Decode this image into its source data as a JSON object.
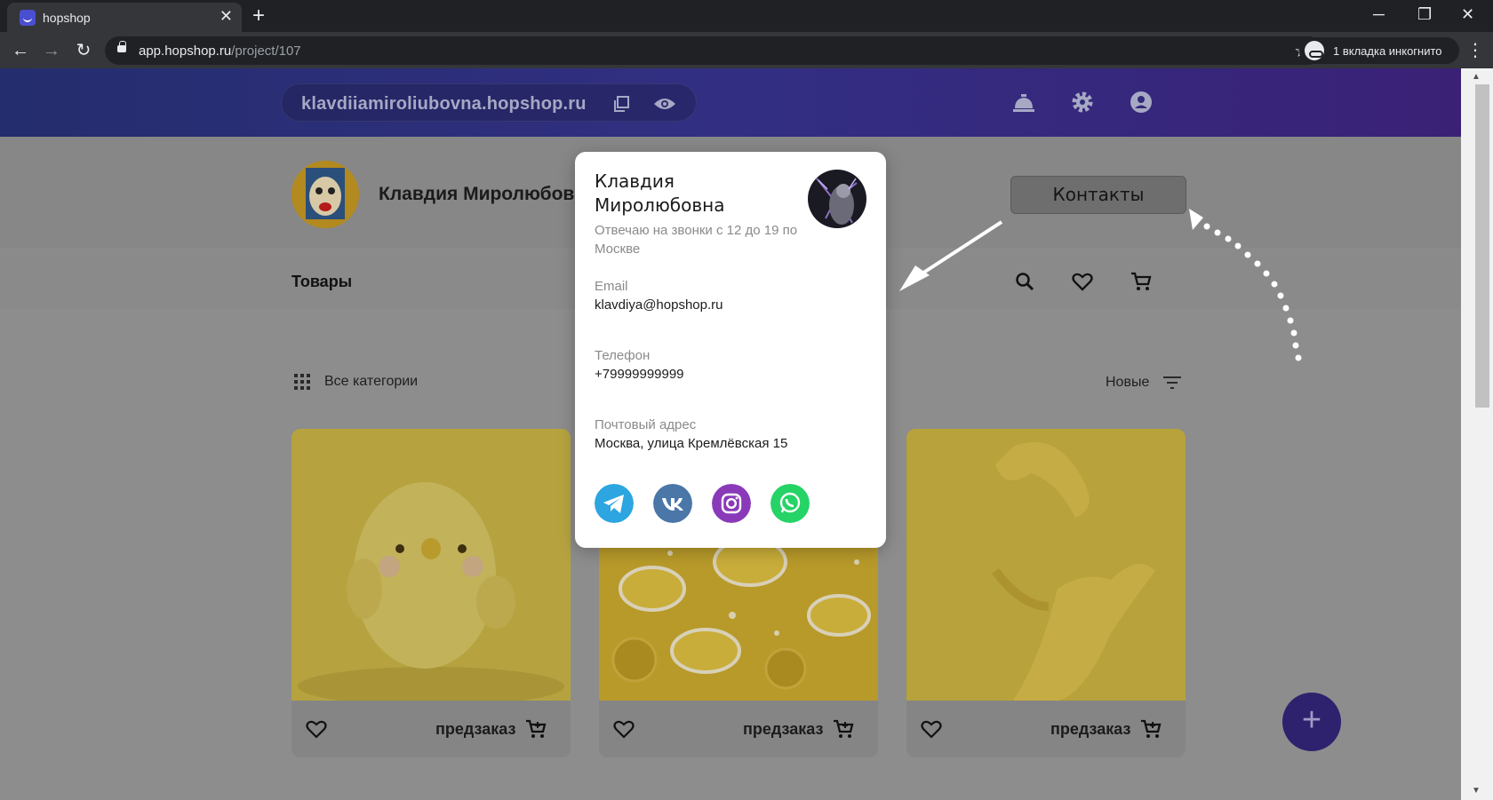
{
  "browser": {
    "tab_title": "hopshop",
    "tab_close": "✕",
    "new_tab": "+",
    "url_host": "app.hopshop.ru",
    "url_path": "/project/107",
    "incognito_label": "1 вкладка инкогнито",
    "win_minimize": "─",
    "win_restore": "❐",
    "win_close": "✕"
  },
  "header": {
    "shop_url": "klavdiiamiroliubovna.hopshop.ru",
    "icons": [
      "copy-icon",
      "eye-icon",
      "bell-icon",
      "settings-icon",
      "account-icon"
    ]
  },
  "profile": {
    "name": "Клавдия Миролюбовна",
    "contacts_button": "Контакты"
  },
  "nav": {
    "goods": "Товары",
    "icons": [
      "search-icon",
      "heart-icon",
      "cart-icon"
    ]
  },
  "filters": {
    "categories": "Все категории",
    "sort": "Новые"
  },
  "cards": [
    {
      "label": "предзаказ",
      "image": "yellow chick toy"
    },
    {
      "label": "предзаказ",
      "image": "macarons and lemons"
    },
    {
      "label": "предзаказ",
      "image": "yellow hands"
    }
  ],
  "fab": "+",
  "contact_popup": {
    "name": "Клавдия Миролюбовна",
    "hours": "Отвечаю на звонки с 12 до 19 по Москве",
    "email_label": "Email",
    "email": "klavdiya@hopshop.ru",
    "phone_label": "Телефон",
    "phone": "+79999999999",
    "address_label": "Почтовый адрес",
    "address": "Москва, улица Кремлёвская 15",
    "socials": [
      "telegram-icon",
      "vk-icon",
      "instagram-icon",
      "whatsapp-icon"
    ]
  },
  "colors": {
    "header_gradient_start": "#242d6d",
    "header_gradient_end": "#3a2176",
    "overlay": "#8d8d8d",
    "telegram": "#2ca5e0",
    "vk": "#4a76a8",
    "instagram": "#8a3ab9",
    "whatsapp": "#25d366"
  }
}
